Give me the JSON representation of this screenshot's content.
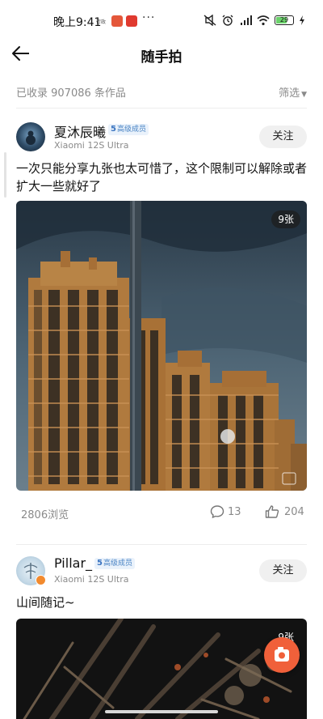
{
  "status_bar": {
    "time": "晚上9:41",
    "battery": "29",
    "accent_colors": {
      "weibo": "#e4573a",
      "app2": "#e03a2f"
    }
  },
  "header": {
    "title": "随手拍",
    "back_icon": "arrow-left-icon"
  },
  "filter_bar": {
    "collected_text": "已收录 907086 条作品",
    "filter_label": "筛选"
  },
  "posts": [
    {
      "author": "夏沐辰曦",
      "badge_level": "5",
      "badge_text": "高级成员",
      "device": "Xiaomi 12S Ultra",
      "follow_label": "关注",
      "text": "一次只能分享九张也太可惜了，这个限制可以解除或者扩大一些就好了",
      "photo_count": "9张",
      "views": "2806浏览",
      "comments": "13",
      "likes": "204"
    },
    {
      "author": "Pillar_",
      "badge_level": "5",
      "badge_text": "高级成员",
      "device": "Xiaomi 12S Ultra",
      "follow_label": "关注",
      "text": "山间随记~",
      "photo_count": "9张"
    }
  ],
  "colors": {
    "fab": "#f0603a",
    "badge_text": "#4a84c4",
    "muted": "#8a8a8a"
  }
}
